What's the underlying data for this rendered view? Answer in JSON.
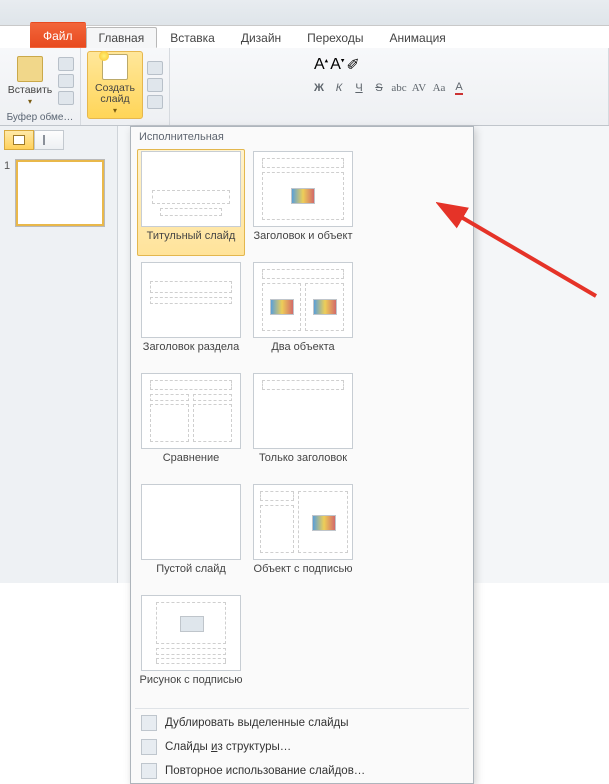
{
  "tabs": {
    "file": "Файл",
    "home": "Главная",
    "insert": "Вставка",
    "design": "Дизайн",
    "transitions": "Переходы",
    "animation": "Анимация"
  },
  "ribbon": {
    "paste": "Вставить",
    "clipboard_group": "Буфер обме…",
    "new_slide": "Создать слайд",
    "text_btns": {
      "bold": "Ж",
      "italic": "К",
      "underline": "Ч",
      "strike": "S",
      "shadow": "abc",
      "spacing": "AV",
      "case": "Aa"
    },
    "font_grow": "A",
    "font_shrink": "A"
  },
  "slidepane": {
    "view1_name": "normal-view-toggle",
    "view2_name": "outline-view-toggle",
    "thumb1_num": "1"
  },
  "gallery": {
    "header": "Исполнительная",
    "layouts": [
      {
        "label": "Титульный слайд",
        "name": "layout-title-slide",
        "kind": "title",
        "selected": true
      },
      {
        "label": "Заголовок и объект",
        "name": "layout-title-and-content",
        "kind": "title-content"
      },
      {
        "label": "Заголовок раздела",
        "name": "layout-section-header",
        "kind": "section"
      },
      {
        "label": "Два объекта",
        "name": "layout-two-content",
        "kind": "two"
      },
      {
        "label": "Сравнение",
        "name": "layout-comparison",
        "kind": "compare"
      },
      {
        "label": "Только заголовок",
        "name": "layout-title-only",
        "kind": "title-only"
      },
      {
        "label": "Пустой слайд",
        "name": "layout-blank",
        "kind": "blank"
      },
      {
        "label": "Объект с подписью",
        "name": "layout-content-caption",
        "kind": "caption"
      },
      {
        "label": "Рисунок с подписью",
        "name": "layout-picture-caption",
        "kind": "picture"
      }
    ],
    "items": [
      {
        "label": "Дублировать выделенные слайды",
        "name": "duplicate-selected-slides"
      },
      {
        "label": "Слайды из структуры…",
        "name": "slides-from-outline"
      },
      {
        "label": "Повторное использование слайдов…",
        "name": "reuse-slides"
      }
    ]
  }
}
